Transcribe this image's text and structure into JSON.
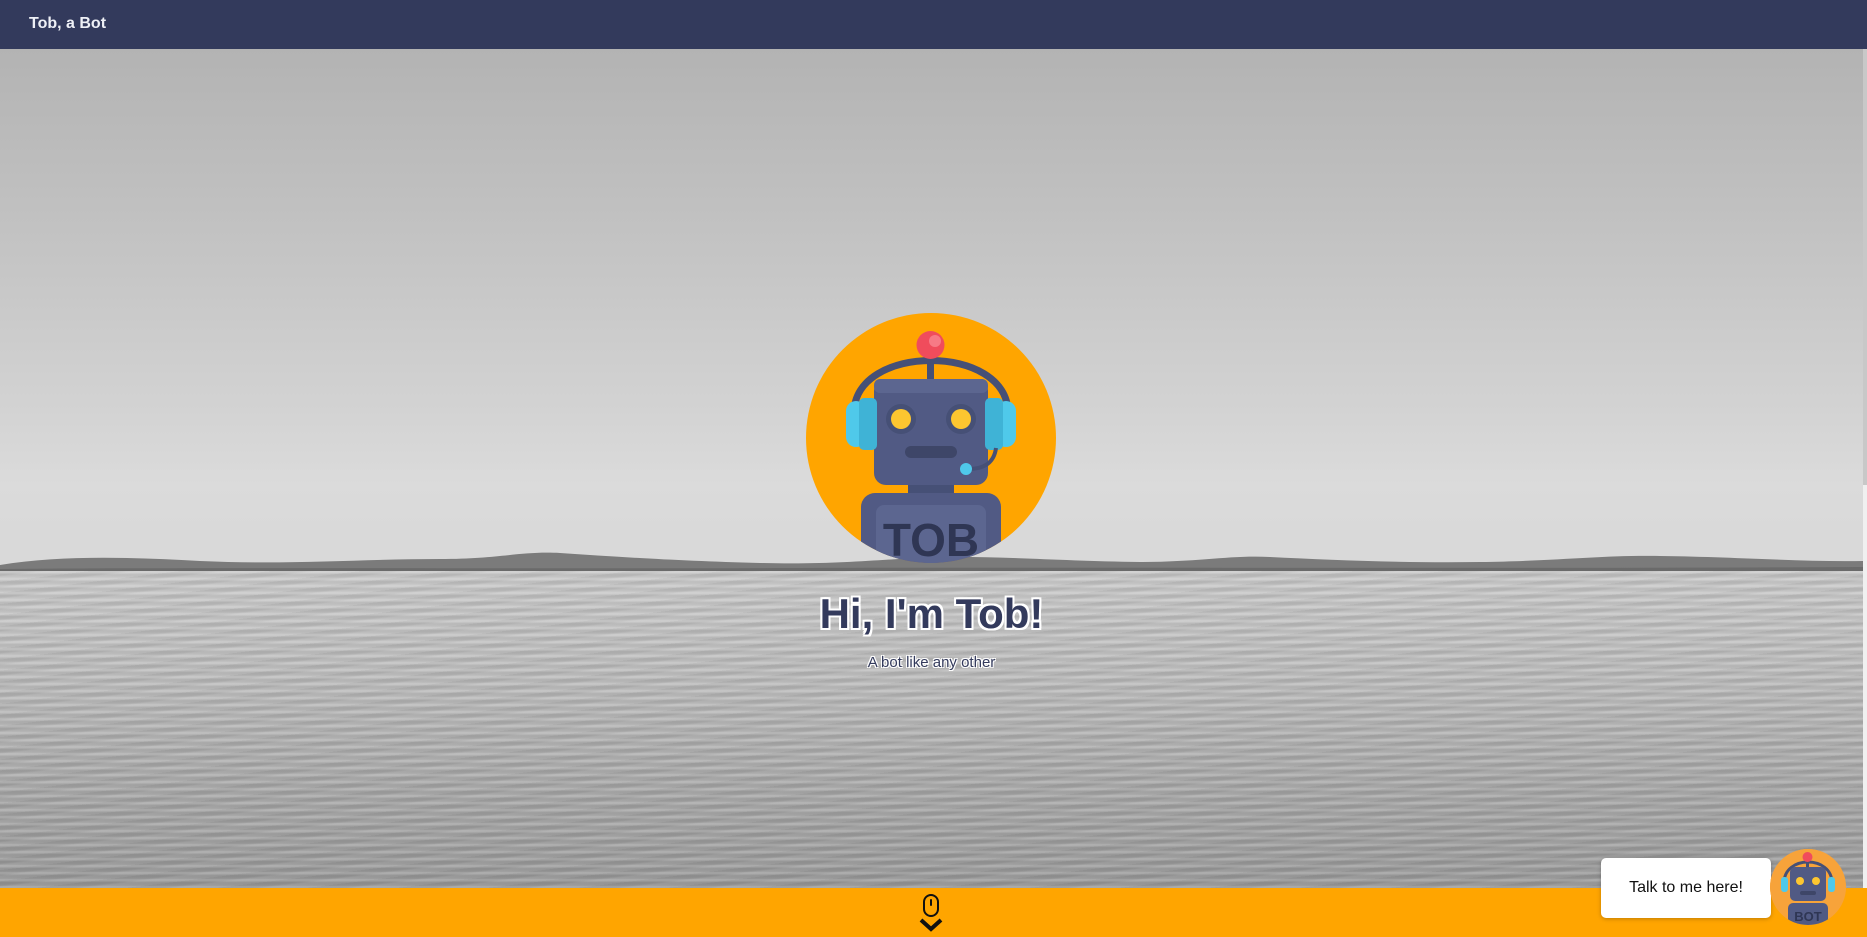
{
  "navbar": {
    "brand": "Tob, a Bot"
  },
  "hero": {
    "avatar_label": "TOB",
    "title": "Hi, I'm Tob!",
    "subtitle": "A bot like any other"
  },
  "chat": {
    "prompt": "Talk to me here!",
    "launcher_label": "BOT"
  },
  "icons": {
    "scroll": "mouse-scroll-down-icon",
    "avatar": "robot-headset-icon"
  },
  "colors": {
    "navbar": "#333a5c",
    "accent": "#ffa500",
    "robot_body": "#515a84",
    "robot_eye": "#fdc630",
    "headphone": "#4fc9ea",
    "antenna_ball": "#f04c5c"
  }
}
